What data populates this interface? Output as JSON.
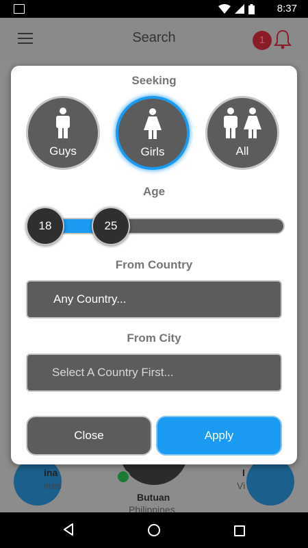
{
  "status_bar": {
    "time": "8:37"
  },
  "appbar": {
    "title": "Search",
    "notification_count": "1"
  },
  "background": {
    "card_left": {
      "name": "ina",
      "country": "ines"
    },
    "card_center": {
      "name": "Butuan",
      "country": "Philippines"
    },
    "card_right": {
      "name": "I",
      "country": "Vi"
    }
  },
  "dialog": {
    "seeking_label": "Seeking",
    "seeking_options": [
      {
        "label": "Guys",
        "icon": "male-icon",
        "selected": false
      },
      {
        "label": "Girls",
        "icon": "female-icon",
        "selected": true
      },
      {
        "label": "All",
        "icon": "male-female-icon",
        "selected": false
      }
    ],
    "age_label": "Age",
    "age_min": "18",
    "age_max": "25",
    "country_label": "From Country",
    "country_value": "Any Country...",
    "city_label": "From City",
    "city_value": "Select A Country First...",
    "close_label": "Close",
    "apply_label": "Apply"
  },
  "colors": {
    "accent": "#1a9af0",
    "control_bg": "#5c5c5c",
    "control_border": "#c6c6c6",
    "label_gray": "#757575",
    "badge": "#8a1c28"
  }
}
